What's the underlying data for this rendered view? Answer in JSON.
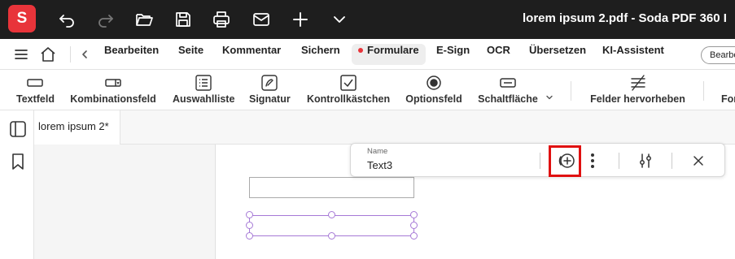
{
  "app": {
    "logo_letter": "S",
    "window_title": "lorem ipsum 2.pdf  -  Soda PDF 360 I",
    "accent": "#e8343a",
    "titlebar_icons": [
      "undo-icon",
      "redo-icon",
      "open-folder-icon",
      "save-icon",
      "print-icon",
      "mail-icon",
      "plus-icon",
      "chevron-down-icon"
    ]
  },
  "menubar": {
    "items": [
      {
        "label": "Bearbeiten"
      },
      {
        "label": "Seite"
      },
      {
        "label": "Kommentar"
      },
      {
        "label": "Sichern"
      },
      {
        "label": "Formulare",
        "active": true
      },
      {
        "label": "E-Sign"
      },
      {
        "label": "OCR"
      },
      {
        "label": "Übersetzen"
      },
      {
        "label": "KI-Assistent"
      }
    ],
    "right_button": "Bearbe"
  },
  "ribbon": {
    "items": [
      {
        "label": "Textfeld",
        "icon": "textfield-icon"
      },
      {
        "label": "Kombinationsfeld",
        "icon": "combobox-icon"
      },
      {
        "label": "Auswahlliste",
        "icon": "listbox-icon"
      },
      {
        "label": "Signatur",
        "icon": "signature-icon"
      },
      {
        "label": "Kontrollkästchen",
        "icon": "checkbox-icon"
      },
      {
        "label": "Optionsfeld",
        "icon": "radio-icon"
      },
      {
        "label": "Schaltfläche",
        "icon": "button-icon"
      },
      {
        "label": "Felder hervorheben",
        "icon": "highlight-fields-icon"
      },
      {
        "label": "For",
        "icon": ""
      }
    ]
  },
  "tabs": {
    "document_tab": "lorem ipsum 2*"
  },
  "field_toolbar": {
    "name_label": "Name",
    "name_value": "Text3",
    "icons": [
      "add-circle-icon",
      "more-vertical-icon",
      "properties-sliders-icon",
      "close-icon"
    ],
    "highlight_color": "#e01010"
  },
  "colors": {
    "selected_field": "#a679d6"
  }
}
